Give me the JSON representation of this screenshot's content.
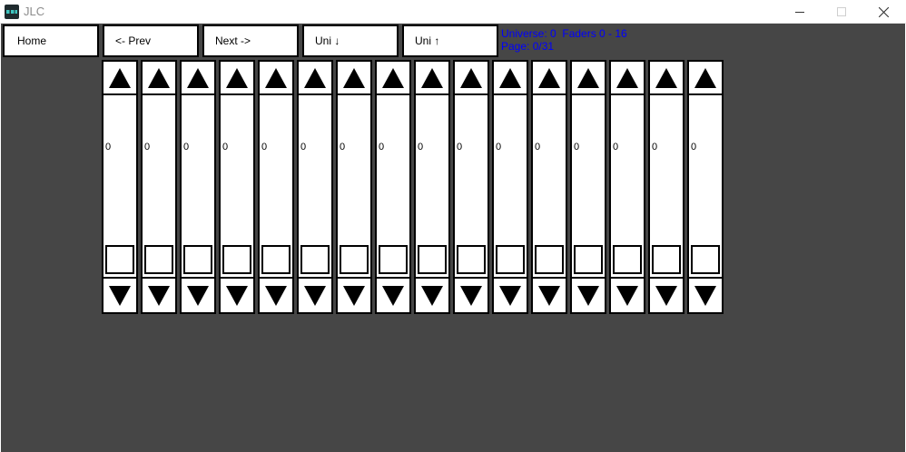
{
  "window": {
    "title": "JLC",
    "controls": {
      "minimize_icon": "minimize-icon",
      "maximize_icon": "maximize-icon",
      "close_icon": "close-icon"
    }
  },
  "toolbar": {
    "home_label": "Home",
    "prev_label": "<- Prev",
    "next_label": "Next ->",
    "uni_down_label": "Uni ↓",
    "uni_up_label": "Uni ↑"
  },
  "info": {
    "universe_line": "Universe: 0  Faders 0 - 16",
    "page_line": "Page: 0/31",
    "color": "#0000ff"
  },
  "faders": [
    {
      "value": "0"
    },
    {
      "value": "0"
    },
    {
      "value": "0"
    },
    {
      "value": "0"
    },
    {
      "value": "0"
    },
    {
      "value": "0"
    },
    {
      "value": "0"
    },
    {
      "value": "0"
    },
    {
      "value": "0"
    },
    {
      "value": "0"
    },
    {
      "value": "0"
    },
    {
      "value": "0"
    },
    {
      "value": "0"
    },
    {
      "value": "0"
    },
    {
      "value": "0"
    },
    {
      "value": "0"
    }
  ],
  "colors": {
    "background": "#464646",
    "button_fill": "#ffffff",
    "border": "#000000"
  }
}
